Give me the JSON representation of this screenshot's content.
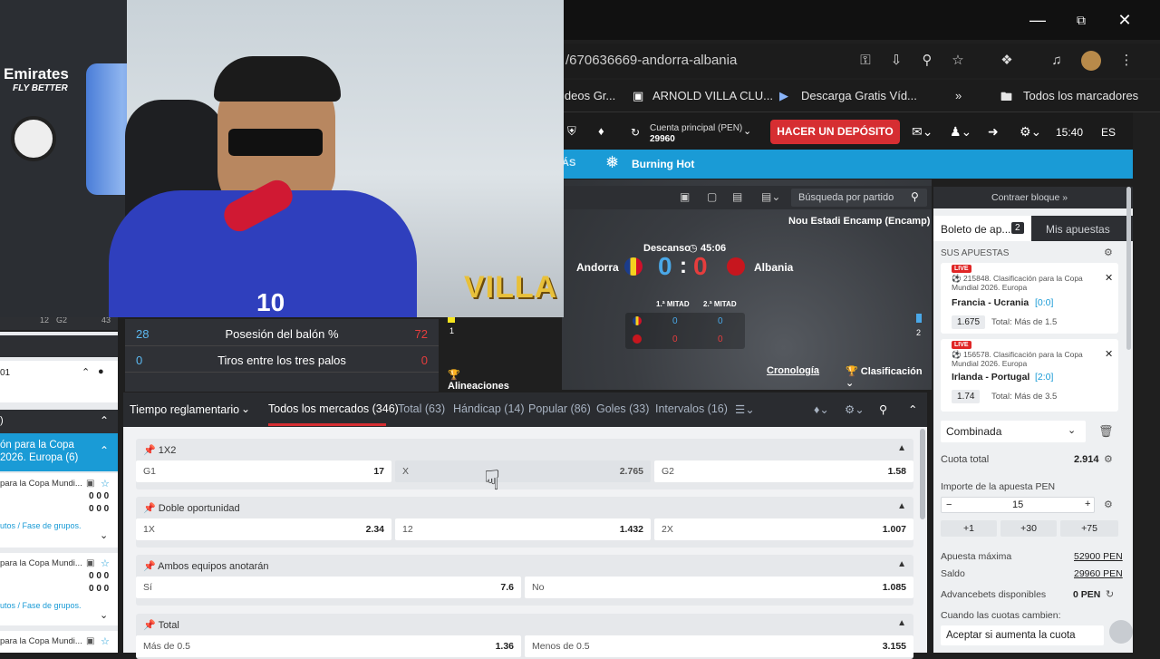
{
  "browser": {
    "url": "/670636669-andorra-albania",
    "bookmarks": [
      "ideos Gr...",
      "ARNOLD VILLA CLU...",
      "Descarga Gratis Víd...",
      "Todos los marcadores"
    ]
  },
  "site": {
    "account_label": "Cuenta principal (PEN)",
    "account_value": "29960",
    "deposit": "HACER UN DEPÓSITO",
    "time": "15:40",
    "lang": "ES",
    "nav_more": "ÁS",
    "nav_game": "Burning Hot"
  },
  "match": {
    "search_placeholder": "Búsqueda por partido",
    "venue": "Nou Estadi Encamp (Encamp)",
    "status": "Descanso",
    "clock": "45:06",
    "home": "Andorra",
    "away": "Albania",
    "home_score": "0",
    "away_score": "0",
    "half1": "1.ª MITAD",
    "half2": "2.ª MITAD",
    "h1_home": "0",
    "h2_home": "0",
    "h1_away": "0",
    "h2_away": "0",
    "timeline_left": "1",
    "timeline_right": "2",
    "lineups": "Alineaciones",
    "chronology": "Cronología",
    "standings": "Clasificación",
    "stats": [
      {
        "home": "28",
        "label": "Posesión del balón %",
        "away": "72"
      },
      {
        "home": "0",
        "label": "Tiros entre los tres palos",
        "away": "0"
      }
    ]
  },
  "markets": {
    "period": "Tiempo reglamentario",
    "tabs": [
      "Todos los mercados (346)",
      "Total (63)",
      "Hándicap (14)",
      "Popular (86)",
      "Goles (33)",
      "Intervalos (16)"
    ],
    "sections": [
      {
        "title": "1X2",
        "odds": [
          [
            "G1",
            "17"
          ],
          [
            "X",
            "2.765"
          ],
          [
            "G2",
            "1.58"
          ]
        ]
      },
      {
        "title": "Doble oportunidad",
        "odds": [
          [
            "1X",
            "2.34"
          ],
          [
            "12",
            "1.432"
          ],
          [
            "2X",
            "1.007"
          ]
        ]
      },
      {
        "title": "Ambos equipos anotarán",
        "odds": [
          [
            "Sí",
            "7.6"
          ],
          [
            "No",
            "1.085"
          ]
        ]
      },
      {
        "title": "Total",
        "odds": [
          [
            "Más de 0.5",
            "1.36"
          ],
          [
            "Menos de 0.5",
            "3.155"
          ]
        ]
      }
    ]
  },
  "left": {
    "row_top": [
      "12",
      "G2",
      "43"
    ],
    "row_id": "01",
    "league": "ón para la Copa\n2026. Europa (6)",
    "items": [
      {
        "name": "para la Copa Mundi...",
        "s1": "0 0 0",
        "s2": "0 0 0",
        "sub": "utos / Fase de grupos."
      },
      {
        "name": "para la Copa Mundi...",
        "s1": "0 0 0",
        "s2": "0 0 0",
        "sub": "utos / Fase de grupos."
      },
      {
        "name": "para la Copa Mundi...",
        "s1": "0 0 0",
        "s2": "",
        "sub": ""
      }
    ]
  },
  "slip": {
    "collapse": "Contraer bloque »",
    "tab_slip": "Boleto de ap...",
    "tab_count": "2",
    "tab_mine": "Mis apuestas",
    "your_bets": "SUS APUESTAS",
    "bets": [
      {
        "live": "LIVE",
        "title": "215848. Clasificación para la Copa Mundial 2026. Europa",
        "match": "Francia - Ucrania",
        "score": "[0:0]",
        "odd": "1.675",
        "market": "Total: Más de 1.5"
      },
      {
        "live": "LIVE",
        "title": "156578. Clasificación para la Copa Mundial 2026. Europa",
        "match": "Irlanda - Portugal",
        "score": "[2:0]",
        "odd": "1.74",
        "market": "Total: Más de 3.5"
      }
    ],
    "type": "Combinada",
    "total_label": "Cuota total",
    "total_value": "2.914",
    "stake_label": "Importe de la apuesta PEN",
    "stake": "15",
    "quick": [
      "+1",
      "+30",
      "+75"
    ],
    "max_label": "Apuesta máxima",
    "max_value": "52900 PEN",
    "balance_label": "Saldo",
    "balance_value": "29960 PEN",
    "advance_label": "Advancebets disponibles",
    "advance_value": "0 PEN",
    "change_label": "Cuando las cuotas cambien:",
    "change_value": "Aceptar si aumenta la cuota"
  },
  "cam": {
    "logo_text": "VILLA",
    "shirt_number": "10",
    "wall_text": "Emirates",
    "wall_sub": "FLY BETTER"
  },
  "colors": {
    "accent_blue": "#1a9bd6",
    "deposit_red": "#d62e32",
    "home_blue": "#5bb8f0",
    "away_red": "#e53d3d"
  }
}
